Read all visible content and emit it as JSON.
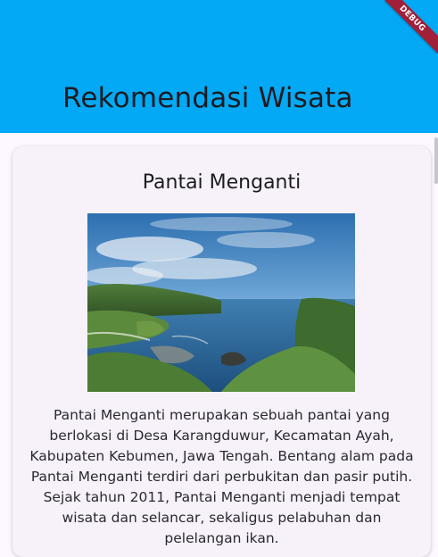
{
  "appbar": {
    "title": "Rekomendasi Wisata",
    "color": "#03a9f4"
  },
  "debug_banner": {
    "label": "DEBUG"
  },
  "card": {
    "title": "Pantai Menganti",
    "description": "Pantai Menganti merupakan sebuah pantai yang berlokasi di Desa Karangduwur, Kecamatan Ayah, Kabupaten Kebumen, Jawa Tengah. Bentang alam pada Pantai Menganti terdiri dari perbukitan dan pasir putih. Sejak tahun 2011, Pantai Menganti menjadi tempat wisata dan selancar, sekaligus pelabuhan dan pelelangan ikan."
  }
}
